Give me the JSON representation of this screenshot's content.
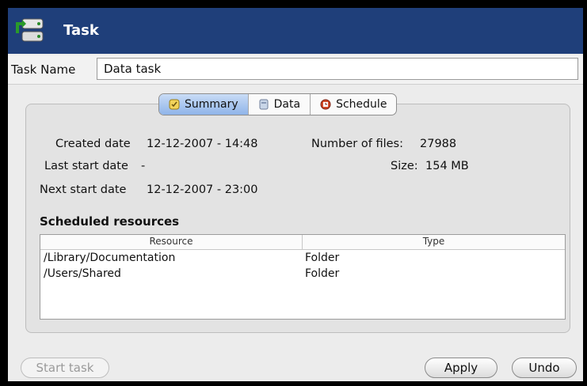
{
  "window": {
    "title": "Task"
  },
  "task_name": {
    "label": "Task Name",
    "value": "Data task"
  },
  "tabs": [
    {
      "label": "Summary",
      "icon": "summary-icon",
      "active": true
    },
    {
      "label": "Data",
      "icon": "data-icon",
      "active": false
    },
    {
      "label": "Schedule",
      "icon": "schedule-icon",
      "active": false
    }
  ],
  "summary": {
    "created_label": "Created date",
    "created_value": "12-12-2007 - 14:48",
    "last_start_label": "Last start date",
    "last_start_value": "-",
    "next_start_label": "Next start date",
    "next_start_value": "12-12-2007 - 23:00",
    "num_files_label": "Number of files:",
    "num_files_value": "27988",
    "size_label": "Size:",
    "size_value": "154 MB"
  },
  "resources": {
    "title": "Scheduled resources",
    "columns": [
      "Resource",
      "Type"
    ],
    "rows": [
      {
        "resource": "/Library/Documentation",
        "type": "Folder"
      },
      {
        "resource": "/Users/Shared",
        "type": "Folder"
      }
    ]
  },
  "buttons": {
    "start": "Start task",
    "apply": "Apply",
    "undo": "Undo"
  },
  "colors": {
    "titlebar": "#1f3f7a",
    "active_tab": "#8fb4e9",
    "panel": "#e3e3e3"
  }
}
